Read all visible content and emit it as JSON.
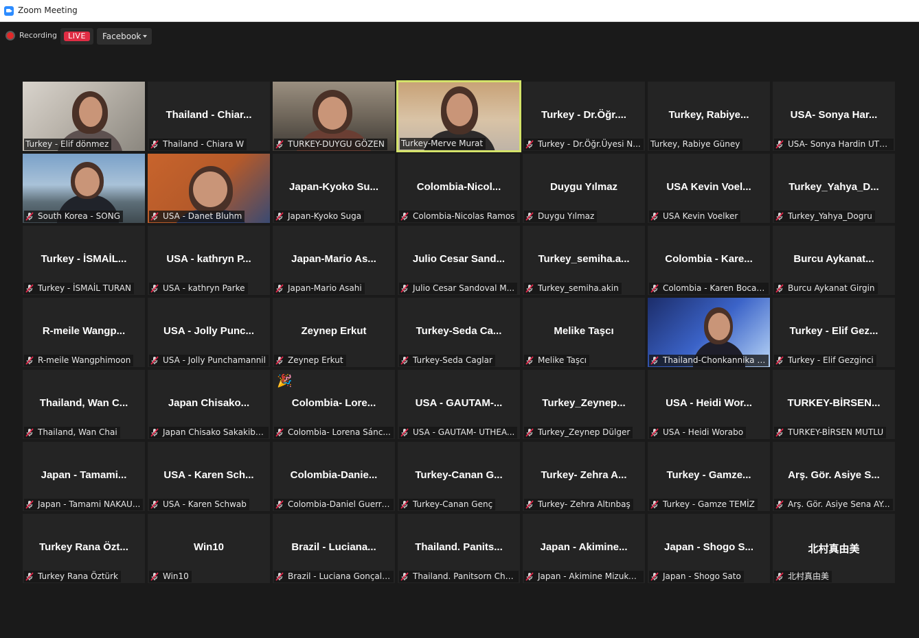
{
  "window": {
    "title": "Zoom Meeting"
  },
  "recording": {
    "label": "Recording",
    "live_badge": "LIVE",
    "stream_target": "Facebook"
  },
  "colors": {
    "live": "#e02d44",
    "active_speaker_border": "#d4e36a",
    "mute": "#e0284a"
  },
  "tiles": [
    {
      "center": "",
      "label": "Turkey - Elif dönmez",
      "muted": false,
      "video": "v1"
    },
    {
      "center": "Thailand - Chiar...",
      "label": "Thailand - Chiara W",
      "muted": true,
      "video": ""
    },
    {
      "center": "",
      "label": "TURKEY-DUYGU GÖZEN",
      "muted": true,
      "video": "v2"
    },
    {
      "center": "",
      "label": "Turkey-Merve Murat",
      "muted": false,
      "video": "v3",
      "active": true
    },
    {
      "center": "Turkey - Dr.Öğr....",
      "label": "Turkey - Dr.Öğr.Üyesi N...",
      "muted": true,
      "video": ""
    },
    {
      "center": "Turkey, Rabiye...",
      "label": "Turkey, Rabiye Güney",
      "muted": false,
      "video": ""
    },
    {
      "center": "USA- Sonya Har...",
      "label": "USA- Sonya Hardin UTH...",
      "muted": true,
      "video": ""
    },
    {
      "center": "",
      "label": "South Korea - SONG",
      "muted": true,
      "video": "v4"
    },
    {
      "center": "",
      "label": "USA - Danet Bluhm",
      "muted": true,
      "video": "v5"
    },
    {
      "center": "Japan-Kyoko Su...",
      "label": "Japan-Kyoko Suga",
      "muted": true,
      "video": ""
    },
    {
      "center": "Colombia-Nicol...",
      "label": "Colombia-Nicolas Ramos",
      "muted": true,
      "video": ""
    },
    {
      "center": "Duygu Yılmaz",
      "label": "Duygu Yılmaz",
      "muted": true,
      "video": ""
    },
    {
      "center": "USA Kevin Voel...",
      "label": "USA Kevin Voelker",
      "muted": true,
      "video": ""
    },
    {
      "center": "Turkey_Yahya_D...",
      "label": "Turkey_Yahya_Dogru",
      "muted": true,
      "video": ""
    },
    {
      "center": "Turkey - İSMAİL...",
      "label": "Turkey - İSMAİL TURAN",
      "muted": true,
      "video": ""
    },
    {
      "center": "USA - kathryn P...",
      "label": "USA - kathryn Parke",
      "muted": true,
      "video": ""
    },
    {
      "center": "Japan-Mario As...",
      "label": "Japan-Mario Asahi",
      "muted": true,
      "video": ""
    },
    {
      "center": "Julio Cesar Sand...",
      "label": "Julio Cesar Sandoval M...",
      "muted": true,
      "video": ""
    },
    {
      "center": "Turkey_semiha.a...",
      "label": "Turkey_semiha.akin",
      "muted": true,
      "video": ""
    },
    {
      "center": "Colombia - Kare...",
      "label": "Colombia - Karen Bocan...",
      "muted": true,
      "video": ""
    },
    {
      "center": "Burcu Aykanat...",
      "label": "Burcu Aykanat Girgin",
      "muted": true,
      "video": ""
    },
    {
      "center": "R-meile Wangp...",
      "label": "R-meile Wangphimoon",
      "muted": true,
      "video": ""
    },
    {
      "center": "USA - Jolly Punc...",
      "label": "USA - Jolly Punchamannil",
      "muted": true,
      "video": ""
    },
    {
      "center": "Zeynep Erkut",
      "label": "Zeynep Erkut",
      "muted": true,
      "video": ""
    },
    {
      "center": "Turkey-Seda Ca...",
      "label": "Turkey-Seda Caglar",
      "muted": true,
      "video": ""
    },
    {
      "center": "Melike Taşcı",
      "label": "Melike Taşcı",
      "muted": true,
      "video": ""
    },
    {
      "center": "",
      "label": "Thailand-Chonkannika N...",
      "muted": true,
      "video": "v6"
    },
    {
      "center": "Turkey - Elif Gez...",
      "label": "Turkey - Elif Gezginci",
      "muted": true,
      "video": ""
    },
    {
      "center": "Thailand, Wan C...",
      "label": "Thailand, Wan Chai",
      "muted": true,
      "video": ""
    },
    {
      "center": "Japan Chisako...",
      "label": "Japan Chisako Sakakiba...",
      "muted": true,
      "video": ""
    },
    {
      "center": "Colombia- Lore...",
      "label": "Colombia- Lorena Sánc...",
      "muted": true,
      "video": "",
      "reaction": "🎉"
    },
    {
      "center": "USA - GAUTAM-...",
      "label": "USA - GAUTAM- UTHEA...",
      "muted": true,
      "video": ""
    },
    {
      "center": "Turkey_Zeynep...",
      "label": "Turkey_Zeynep Dülger",
      "muted": true,
      "video": ""
    },
    {
      "center": "USA - Heidi Wor...",
      "label": "USA - Heidi Worabo",
      "muted": true,
      "video": ""
    },
    {
      "center": "TURKEY-BİRSEN...",
      "label": "TURKEY-BİRSEN MUTLU",
      "muted": true,
      "video": ""
    },
    {
      "center": "Japan - Tamami...",
      "label": "Japan - Tamami NAKAU...",
      "muted": true,
      "video": ""
    },
    {
      "center": "USA - Karen Sch...",
      "label": "USA - Karen Schwab",
      "muted": true,
      "video": ""
    },
    {
      "center": "Colombia-Danie...",
      "label": "Colombia-Daniel Guerre...",
      "muted": true,
      "video": ""
    },
    {
      "center": "Turkey-Canan G...",
      "label": "Turkey-Canan Genç",
      "muted": true,
      "video": ""
    },
    {
      "center": "Turkey- Zehra A...",
      "label": "Turkey- Zehra Altınbaş",
      "muted": true,
      "video": ""
    },
    {
      "center": "Turkey - Gamze...",
      "label": "Turkey - Gamze TEMİZ",
      "muted": true,
      "video": ""
    },
    {
      "center": "Arş. Gör. Asiye S...",
      "label": "Arş. Gör. Asiye Sena AY...",
      "muted": true,
      "video": ""
    },
    {
      "center": "Turkey Rana Özt...",
      "label": "Turkey Rana Öztürk",
      "muted": true,
      "video": ""
    },
    {
      "center": "Win10",
      "label": "Win10",
      "muted": true,
      "video": ""
    },
    {
      "center": "Brazil - Luciana...",
      "label": "Brazil - Luciana Gonçalves",
      "muted": true,
      "video": ""
    },
    {
      "center": "Thailand. Panits...",
      "label": "Thailand. Panitsorn Char...",
      "muted": true,
      "video": ""
    },
    {
      "center": "Japan - Akimine...",
      "label": "Japan - Akimine Mizuko...",
      "muted": true,
      "video": ""
    },
    {
      "center": "Japan - Shogo S...",
      "label": "Japan - Shogo Sato",
      "muted": true,
      "video": ""
    },
    {
      "center": "北村真由美",
      "label": "北村真由美",
      "muted": true,
      "video": ""
    }
  ]
}
